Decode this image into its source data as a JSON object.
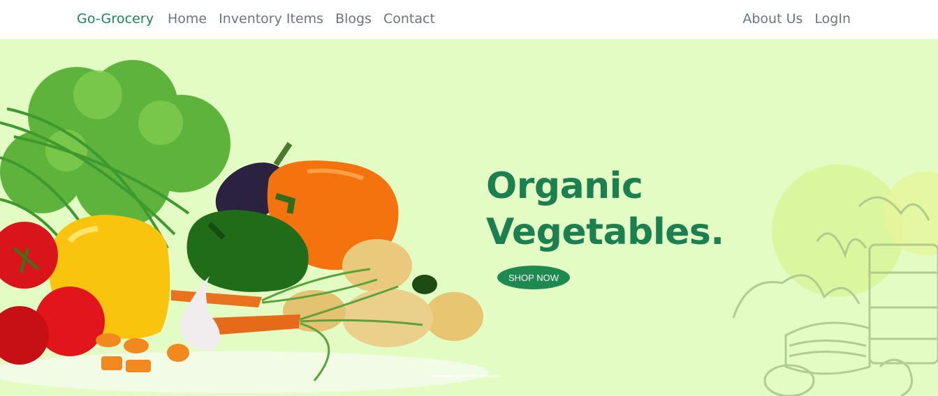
{
  "navbar": {
    "brand": "Go-Grocery",
    "left_links": [
      "Home",
      "Inventory Items",
      "Blogs",
      "Contact"
    ],
    "right_links": [
      "About Us",
      "LogIn"
    ]
  },
  "hero": {
    "title_line1": "Organic",
    "title_line2": "Vegetables.",
    "button_label": "SHOP NOW",
    "active_slide": 1,
    "slide_count": 3
  },
  "colors": {
    "brand_green": "#198754",
    "hero_bg": "#e2fcc4",
    "title_green": "#1b7f4f",
    "button_green": "#1d8a50"
  }
}
